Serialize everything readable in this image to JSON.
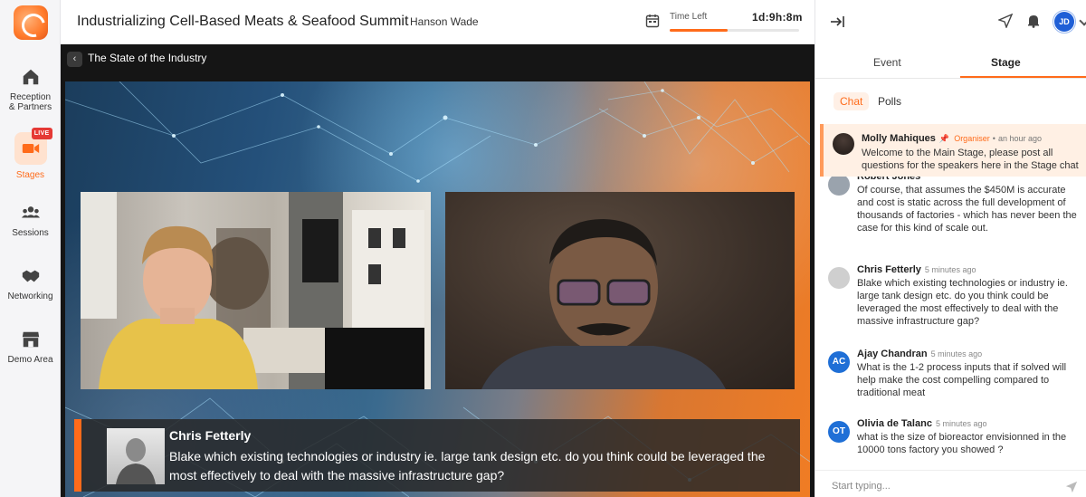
{
  "nav": {
    "items": [
      {
        "label": "Reception\n& Partners",
        "icon": "home-icon"
      },
      {
        "label": "Stages",
        "icon": "video-camera-icon",
        "badge": "LIVE",
        "active": true
      },
      {
        "label": "Sessions",
        "icon": "group-icon"
      },
      {
        "label": "Networking",
        "icon": "handshake-icon"
      },
      {
        "label": "Demo Area",
        "icon": "storefront-icon"
      }
    ]
  },
  "header": {
    "title": "Industrializing Cell-Based Meats & Seafood Summit",
    "organizer": "Hanson Wade",
    "time_left_label": "Time Left",
    "time_left_value": "1d:9h:8m",
    "time_progress": 0.45
  },
  "stage": {
    "session_title": "The State of the Industry",
    "caption": {
      "name": "Chris Fetterly",
      "text": "Blake which existing technologies or industry ie. large tank design etc. do you think could be leveraged the most effectively to deal with the massive infrastructure gap?"
    }
  },
  "panel": {
    "user_initials": "JD",
    "tabs": [
      "Event",
      "Stage"
    ],
    "active_tab": "Stage",
    "subtabs": [
      "Chat",
      "Polls"
    ],
    "pinned": {
      "name": "Molly Mahiques",
      "role": "Organiser",
      "time": "an hour ago",
      "text": "Welcome to the Main Stage, please post all questions for the speakers here in the Stage chat"
    },
    "messages": [
      {
        "name": "Robert Jones",
        "time": "",
        "initials": "",
        "avatar_color": "#9aa3ad",
        "text": "Of course, that assumes the $450M is accurate and cost is static across the full development of thousands of factories - which has never been the case for this kind of scale out."
      },
      {
        "name": "Chris Fetterly",
        "time": "5 minutes ago",
        "initials": "",
        "avatar_color": "#b9b9b9",
        "text": "Blake which existing technologies or industry ie. large tank design etc. do you think could be leveraged the most effectively to deal with the massive infrastructure gap?"
      },
      {
        "name": "Ajay Chandran",
        "time": "5 minutes ago",
        "initials": "AC",
        "avatar_color": "#1f6fd6",
        "text": "What is the 1-2 process inputs that if solved will help make the cost compelling compared to traditional meat"
      },
      {
        "name": "Olivia de Talanc",
        "time": "5 minutes ago",
        "initials": "OT",
        "avatar_color": "#1f6fd6",
        "text": "what is the size of bioreactor envisionned in the 10000 tons factory you showed ?"
      }
    ],
    "composer_placeholder": "Start typing..."
  },
  "colors": {
    "accent": "#ff6b1a",
    "live_badge": "#e53935",
    "avatar_blue": "#1f6fd6"
  }
}
